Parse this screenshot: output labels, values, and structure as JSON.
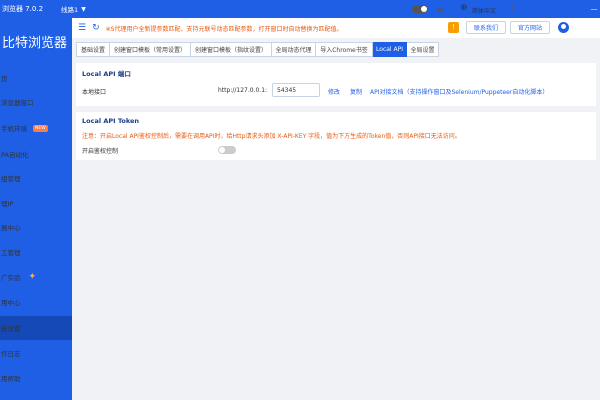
{
  "titlebar": {
    "app_title": "浏览器 7.0.2",
    "line_label": "线路1"
  },
  "sidebar": {
    "logo": "比特浏览器",
    "items": [
      {
        "label": "页"
      },
      {
        "label": "浏览器窗口"
      },
      {
        "label": "手机环境",
        "badge": "NEW"
      },
      {
        "label": "PA自动化"
      },
      {
        "label": "组管理"
      },
      {
        "label": "理IP"
      },
      {
        "label": "展中心"
      },
      {
        "label": "工管理"
      },
      {
        "label": "广实验"
      },
      {
        "label": "用中心"
      },
      {
        "label": "统设置"
      },
      {
        "label": "作日志"
      },
      {
        "label": "用帮助"
      }
    ]
  },
  "header": {
    "notice": "※S代理用户全新提参数匹配，支持元联号动态匹配参数，打开窗口时自动替换为匹配值。",
    "notice_badge": "!",
    "contact_btn": "联系我们",
    "website_btn": "官方网站",
    "language": "简体中文"
  },
  "tabs": [
    {
      "label": "基础设置"
    },
    {
      "label": "创建窗口模板（常用设置）"
    },
    {
      "label": "创建窗口模板（指纹设置）"
    },
    {
      "label": "全局动态代理"
    },
    {
      "label": "导入Chrome书签"
    },
    {
      "label": "Local API",
      "active": true
    },
    {
      "label": "全局设置"
    }
  ],
  "local_api": {
    "title": "Local API 端口",
    "port_label": "本地接口",
    "url_prefix": "http://127.0.0.1:",
    "port_value": "54345",
    "modify": "修改",
    "copy": "复制",
    "docs_link": "API对接文档（支持操作窗口及Selenium/Puppeteer自动化脚本）"
  },
  "token": {
    "title": "Local API Token",
    "warning": "注意：开启Local API鉴权控制后，需要在调用API时，给Http请求头添加 X-API-KEY 字段，值为下方生成的Token值，否则API接口无法访问。",
    "auth_label": "开启鉴权控制",
    "auth_enabled": false
  },
  "colors": {
    "brand": "#1f5fe6",
    "warning": "#e8590c"
  }
}
